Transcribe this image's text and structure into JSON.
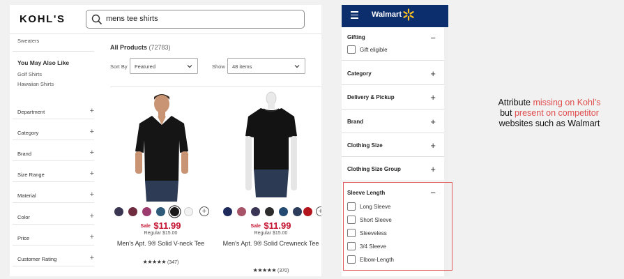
{
  "kohls": {
    "logo": "KOHL'S",
    "search": {
      "value": "mens tee shirts"
    },
    "sidebar": {
      "top_link": "Sweaters",
      "you_may_also_like": {
        "title": "You May Also Like",
        "links": [
          "Golf Shirts",
          "Hawaiian Shirts"
        ]
      },
      "facets": [
        "Department",
        "Category",
        "Brand",
        "Size Range",
        "Material",
        "Color",
        "Price",
        "Customer Rating"
      ]
    },
    "results": {
      "title": "All Products",
      "count": "(72783)",
      "sort_label": "Sort By",
      "sort_value": "Featured",
      "show_label": "Show",
      "show_value": "48 items"
    },
    "products": [
      {
        "sale_label": "Sale",
        "price": "$11.99",
        "regular": "Regular $15.00",
        "title": "Men's Apt. 9® Solid V-neck Tee",
        "stars": "★★★★★",
        "reviews": "(347)",
        "swatches": [
          "#3a3550",
          "#6e2c3e",
          "#9c3b6e",
          "#2c5a78",
          "#1a1a1a",
          "#f2f2f2"
        ],
        "selected_swatch": 4
      },
      {
        "sale_label": "Sale",
        "price": "$11.99",
        "regular": "Regular $15.00",
        "title": "Men's Apt. 9® Solid Crewneck Tee",
        "stars": "★★★★★",
        "reviews": "(370)",
        "swatches": [
          "#1f2a5c",
          "#a85468",
          "#3b3555",
          "#2c2c2c",
          "#234a72",
          "#2b3d5a",
          "#b3151d"
        ],
        "selected_swatch": -1
      }
    ],
    "colors": {
      "sale_red": "#c41230"
    }
  },
  "walmart": {
    "logo": "Walmart",
    "colors": {
      "header": "#0d2e6c",
      "spark": "#ffc220"
    },
    "sections": [
      {
        "title": "Gifting",
        "expanded": true,
        "options": [
          "Gift eligible"
        ]
      },
      {
        "title": "Category",
        "expanded": false
      },
      {
        "title": "Delivery & Pickup",
        "expanded": false
      },
      {
        "title": "Brand",
        "expanded": false
      },
      {
        "title": "Clothing Size",
        "expanded": false
      },
      {
        "title": "Clothing Size Group",
        "expanded": false
      },
      {
        "title": "Sleeve Length",
        "expanded": true,
        "options": [
          "Long Sleeve",
          "Short Sleeve",
          "Sleeveless",
          "3/4 Sleeve",
          "Elbow-Length"
        ]
      }
    ],
    "collapse_symbol": "−",
    "expand_symbol": "+"
  },
  "annotation": {
    "line1_a": "Attribute ",
    "line1_b": "missing on Kohl’s",
    "line2_a": "but ",
    "line2_b": "present on competitor",
    "line3": "websites such as Walmart",
    "highlight_color": "#e14d4d"
  }
}
